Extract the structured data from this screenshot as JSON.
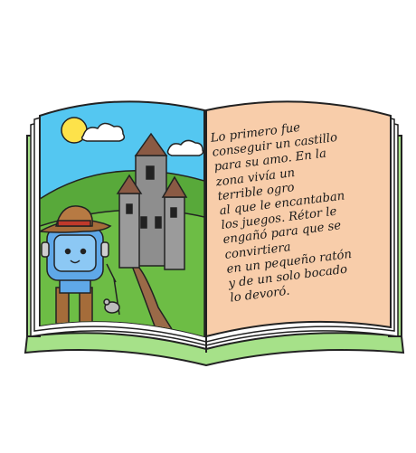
{
  "story": {
    "lines": [
      "Lo primero fue",
      "conseguir un castillo",
      "para su amo. En la",
      "zona vivía un",
      "terrible ogro",
      "al que le encantaban",
      "los juegos. Rétor le",
      "engañó para que se",
      "convirtiera",
      "en un pequeño ratón",
      "y de un solo bocado",
      "lo devoró."
    ]
  },
  "colors": {
    "book_cover": "#a6e189",
    "page_text": "#f8cdaa",
    "sky": "#54c7f1",
    "hill": "#6dbd45",
    "castle": "#8e8e8e",
    "roof": "#8a5a44",
    "sun": "#fde24a",
    "robot": "#5fa8e8",
    "hat": "#a56c3a"
  },
  "icons": [
    "book-icon",
    "castle-icon",
    "sun-icon",
    "cloud-icon",
    "robot-cat-icon",
    "cowboy-hat-icon",
    "mouse-icon"
  ]
}
